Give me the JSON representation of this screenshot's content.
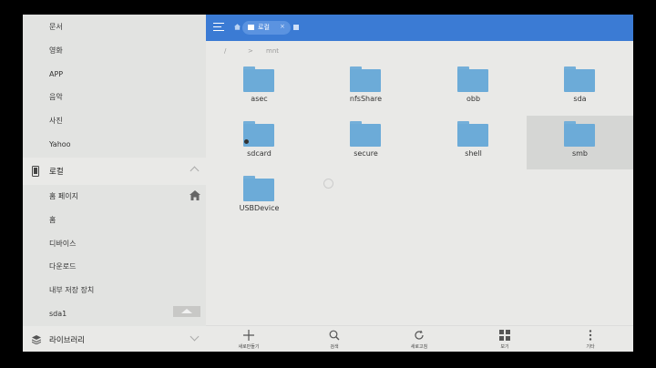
{
  "sidebar": {
    "items_top": [
      "문서",
      "영화",
      "APP",
      "음악",
      "사진",
      "Yahoo"
    ],
    "local_section": "로컬",
    "local_items": [
      "홈 페이지",
      "홈",
      "디바이스",
      "다운로드",
      "내부 저장 장치",
      "sda1"
    ],
    "library_section": "라이브러리"
  },
  "topbar": {
    "tab_label": "로컬",
    "tab_close": "×"
  },
  "path": {
    "root": "/",
    "sep": ">",
    "current": "mnt"
  },
  "folders": [
    "asec",
    "nfsShare",
    "obb",
    "sda",
    "sdcard",
    "secure",
    "shell",
    "smb",
    "USBDevice"
  ],
  "selected_folder": "smb",
  "toolbar": {
    "new": "새로만들기",
    "search": "검색",
    "refresh": "새로고침",
    "view": "보기",
    "more": "기타"
  },
  "colors": {
    "accent": "#3b7bd4",
    "folder": "#6cabd8"
  }
}
